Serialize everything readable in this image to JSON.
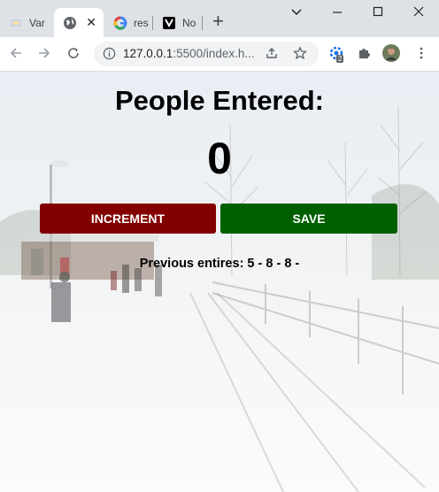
{
  "browser": {
    "tabs": [
      {
        "title": "Var",
        "active": false
      },
      {
        "title": "",
        "active": true
      },
      {
        "title": "res",
        "active": false
      },
      {
        "title": "No",
        "active": false
      }
    ],
    "url_host": "127.0.0.1",
    "url_rest": ":5500/index.h...",
    "extension_badge": "2"
  },
  "page": {
    "heading": "People Entered:",
    "count": "0",
    "increment_label": "INCREMENT",
    "save_label": "SAVE",
    "previous_entries": "Previous entires: 5 - 8 - 8 -"
  },
  "colors": {
    "increment_button": "#830000",
    "save_button": "#006000"
  }
}
